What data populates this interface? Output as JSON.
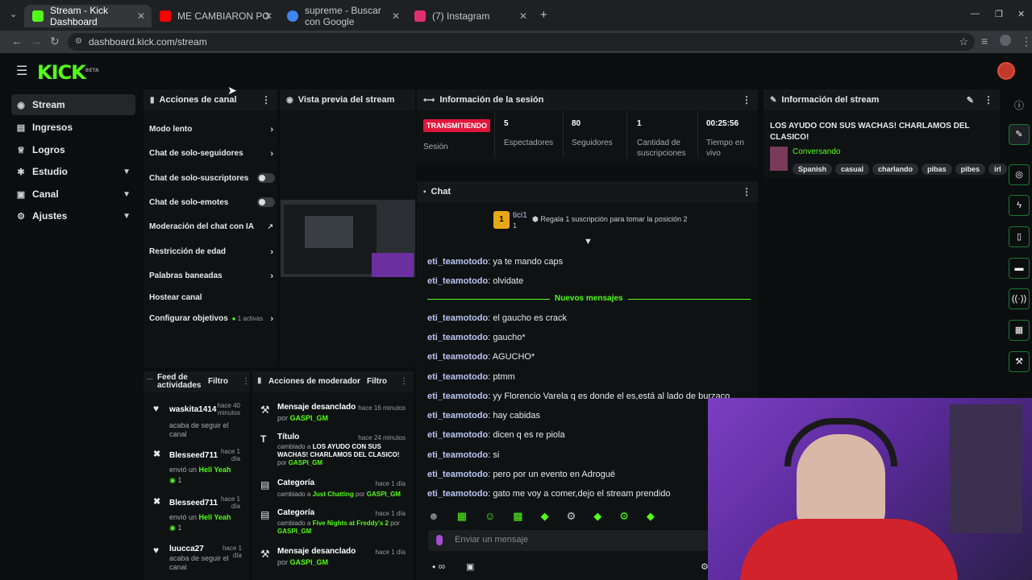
{
  "browser": {
    "tabs": [
      {
        "title": "Stream - Kick Dashboard",
        "fav": "#53fc18"
      },
      {
        "title": "ME CAMBIARON POR EL DINER",
        "fav": "#ff0000"
      },
      {
        "title": "supreme - Buscar con Google",
        "fav": "#4285f4"
      },
      {
        "title": "(7) Instagram",
        "fav": "#e1306c"
      }
    ],
    "new_tab": "+",
    "url": "dashboard.kick.com/stream"
  },
  "app": {
    "logo": "KICK",
    "logo_badge": "BETA"
  },
  "sidebar": {
    "items": [
      {
        "label": "Stream",
        "icon": "broadcast-icon"
      },
      {
        "label": "Ingresos",
        "icon": "wallet-icon"
      },
      {
        "label": "Logros",
        "icon": "trophy-icon"
      },
      {
        "label": "Estudio",
        "icon": "studio-icon"
      },
      {
        "label": "Canal",
        "icon": "channel-icon"
      },
      {
        "label": "Ajustes",
        "icon": "gear-icon"
      }
    ]
  },
  "channel_actions": {
    "title": "Acciones de canal",
    "rows": [
      {
        "label": "Modo lento"
      },
      {
        "label": "Chat de solo-seguidores"
      },
      {
        "label": "Chat de solo-suscriptores"
      },
      {
        "label": "Chat de solo-emotes"
      },
      {
        "label": "Moderación del chat con IA"
      },
      {
        "label": "Restricción de edad"
      },
      {
        "label": "Palabras baneadas"
      },
      {
        "label": "Hostear canal"
      },
      {
        "label": "Configurar objetivos"
      }
    ],
    "goals_badge": "1 activas"
  },
  "preview": {
    "title": "Vista previa del stream"
  },
  "session": {
    "title": "Información de la sesión",
    "live_badge": "TRANSMITIENDO",
    "session_label": "Sesión",
    "stats": [
      {
        "value": "5",
        "label": "Espectadores"
      },
      {
        "value": "80",
        "label": "Seguidores"
      },
      {
        "value": "1",
        "label": "Cantidad de suscripciones"
      },
      {
        "value": "00:25:56",
        "label": "Tiempo en vivo"
      }
    ]
  },
  "stream_info": {
    "title": "Información del stream",
    "stream_title": "LOS AYUDO CON SUS WACHAS! CHARLAMOS DEL CLASICO!",
    "category": "Conversando",
    "tags": [
      "Spanish",
      "casual",
      "charlando",
      "pibas",
      "pibes",
      "irl"
    ]
  },
  "chat": {
    "title": "Chat",
    "pinned_user": "tici1",
    "pinned_rank": "1",
    "pinned_count": "1",
    "gift_prompt": "Regala 1 suscripción para tomar la posición 2",
    "new_messages": "Nuevos mensajes",
    "messages": [
      {
        "user": "eti_teamotodo",
        "text": "ya te mando caps"
      },
      {
        "user": "eti_teamotodo",
        "text": "olvidate"
      },
      {
        "user": "eti_teamotodo",
        "text": "el gaucho es crack"
      },
      {
        "user": "eti_teamotodo",
        "text": "gaucho*"
      },
      {
        "user": "eti_teamotodo",
        "text": "AGUCHO*"
      },
      {
        "user": "eti_teamotodo",
        "text": "ptmm"
      },
      {
        "user": "eti_teamotodo",
        "text": "yy Florencio Varela q es donde el es,está al lado de burzaco"
      },
      {
        "user": "eti_teamotodo",
        "text": "hay cabidas"
      },
      {
        "user": "eti_teamotodo",
        "text": "dicen q es re piola"
      },
      {
        "user": "eti_teamotodo",
        "text": "si"
      },
      {
        "user": "eti_teamotodo",
        "text": "pero por un evento en Adrogué"
      },
      {
        "user": "eti_teamotodo",
        "text": "gato me voy a comer,dejo el stream prendido"
      }
    ],
    "input_placeholder": "Enviar un mensaje",
    "infinity": "∞"
  },
  "activity_feed": {
    "title": "Feed de actividades",
    "filter": "Filtro",
    "items": [
      {
        "icon": "heart-icon",
        "user": "waskita1414",
        "time": "hace 40 minutos",
        "action": "acaba de seguir el canal",
        "highlight": "",
        "count": ""
      },
      {
        "icon": "kick-icon",
        "user": "Blesseed711",
        "time": "hace 1 día",
        "action": "envió un",
        "highlight": "Hell Yeah",
        "count": "1"
      },
      {
        "icon": "kick-icon",
        "user": "Blesseed711",
        "time": "hace 1 día",
        "action": "envió un",
        "highlight": "Hell Yeah",
        "count": "1"
      },
      {
        "icon": "heart-icon",
        "user": "luucca27",
        "time": "hace 1 día",
        "action": "acaba de seguir el canal",
        "highlight": "",
        "count": ""
      }
    ]
  },
  "mod_actions": {
    "title": "Acciones de moderador",
    "filter": "Filtro",
    "items": [
      {
        "icon": "hammer-icon",
        "title": "Mensaje desanclado",
        "time": "hace 16 minutos",
        "pre": "por",
        "mid": "",
        "post": "",
        "mod": "GASPI_GM"
      },
      {
        "icon": "text-icon",
        "title": "Título",
        "time": "hace 24 minutos",
        "pre": "cambiado a",
        "mid": "LOS AYUDO CON SUS WACHAS! CHARLAMOS DEL CLASICO!",
        "post": "por",
        "mod": "GASPI_GM"
      },
      {
        "icon": "calendar-icon",
        "title": "Categoría",
        "time": "hace 1 día",
        "pre": "cambiado a",
        "mid": "Just Chatting",
        "post": "por",
        "mod": "GASPI_GM"
      },
      {
        "icon": "calendar-icon",
        "title": "Categoría",
        "time": "hace 1 día",
        "pre": "cambiado a",
        "mid": "Five Nights at Freddy's 2",
        "post": "por",
        "mod": "GASPI_GM"
      },
      {
        "icon": "hammer-icon",
        "title": "Mensaje desanclado",
        "time": "hace 1 día",
        "pre": "por",
        "mid": "",
        "post": "",
        "mod": "GASPI_GM"
      }
    ]
  },
  "colors": {
    "accent": "#53fc18",
    "live": "#e0153a",
    "user": "#b9c5f0"
  }
}
